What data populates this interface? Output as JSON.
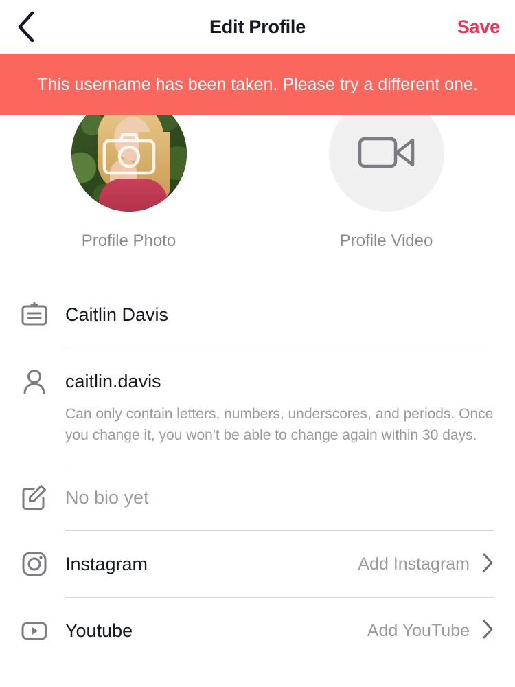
{
  "header": {
    "back_icon": "chevron-left-icon",
    "title": "Edit Profile",
    "save_label": "Save",
    "save_color": "#fe2c55"
  },
  "error_banner": {
    "message": "This username has been taken. Please try a different one.",
    "background_color": "#fb675c",
    "text_color": "#ffffff"
  },
  "media": {
    "photo": {
      "label": "Profile Photo",
      "overlay_icon": "camera-icon"
    },
    "video": {
      "label": "Profile Video",
      "icon": "video-camera-icon",
      "background_color": "#f0f0f0"
    }
  },
  "fields": {
    "name": {
      "icon": "id-card-icon",
      "value": "Caitlin Davis"
    },
    "username": {
      "icon": "person-icon",
      "value": "caitlin.davis",
      "help": "Can only contain letters, numbers, underscores, and periods. Once you change it, you won't be able to change again within 30 days."
    },
    "bio": {
      "icon": "edit-icon",
      "placeholder": "No bio yet"
    }
  },
  "social": [
    {
      "icon": "instagram-icon",
      "label": "Instagram",
      "action": "Add Instagram",
      "chevron": "chevron-right-icon"
    },
    {
      "icon": "youtube-icon",
      "label": "Youtube",
      "action": "Add YouTube",
      "chevron": "chevron-right-icon"
    }
  ]
}
